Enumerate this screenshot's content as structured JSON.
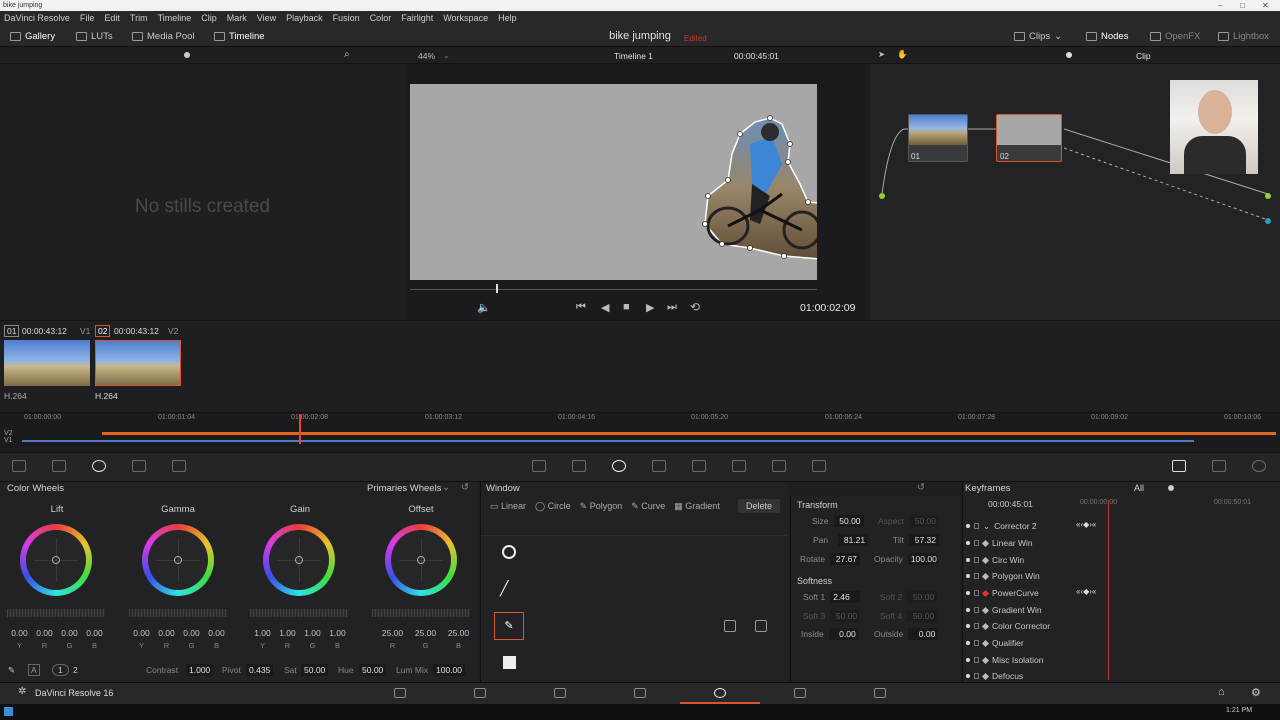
{
  "window": {
    "title": "bike jumping"
  },
  "menu": [
    "DaVinci Resolve",
    "File",
    "Edit",
    "Trim",
    "Timeline",
    "Clip",
    "Mark",
    "View",
    "Playback",
    "Fusion",
    "Color",
    "Fairlight",
    "Workspace",
    "Help"
  ],
  "topbar": {
    "left_tabs": [
      "Gallery",
      "LUTs",
      "Media Pool",
      "Timeline"
    ],
    "project_title": "bike jumping",
    "project_status": "Edited",
    "right_tabs": [
      "Clips",
      "Nodes",
      "OpenFX",
      "Lightbox"
    ]
  },
  "viewer": {
    "zoom": "44%",
    "timeline_name": "Timeline 1",
    "timecode_top": "00:00:45:01",
    "timecode": "01:00:02:09",
    "mode": "Clip"
  },
  "gallery": {
    "empty_text": "No stills created"
  },
  "nodes": [
    {
      "label": "01"
    },
    {
      "label": "02"
    }
  ],
  "clips": [
    {
      "index": "01",
      "timecode": "00:00:43:12",
      "track": "V1",
      "codec": "H.264"
    },
    {
      "index": "02",
      "timecode": "00:00:43:12",
      "track": "V2",
      "codec": "H.264"
    }
  ],
  "timeline_ticks": [
    "01:00:00:00",
    "01:00:01:04",
    "01:00:02:08",
    "01:00:03:12",
    "01:00:04:16",
    "01:00:05:20",
    "01:00:06:24",
    "01:00:07:28",
    "01:00:09:02",
    "01:00:10:06"
  ],
  "timeline_tracks": [
    "V2",
    "V1"
  ],
  "color_wheels": {
    "title": "Color Wheels",
    "mode": "Primaries Wheels",
    "wheels": [
      {
        "name": "Lift",
        "values": [
          "0.00",
          "0.00",
          "0.00",
          "0.00"
        ],
        "labels": [
          "Y",
          "R",
          "G",
          "B"
        ]
      },
      {
        "name": "Gamma",
        "values": [
          "0.00",
          "0.00",
          "0.00",
          "0.00"
        ],
        "labels": [
          "Y",
          "R",
          "G",
          "B"
        ]
      },
      {
        "name": "Gain",
        "values": [
          "1.00",
          "1.00",
          "1.00",
          "1.00"
        ],
        "labels": [
          "Y",
          "R",
          "G",
          "B"
        ]
      },
      {
        "name": "Offset",
        "values": [
          "25.00",
          "25.00",
          "25.00"
        ],
        "labels": [
          "R",
          "G",
          "B"
        ]
      }
    ],
    "page_numbers": [
      "1",
      "2"
    ],
    "params": {
      "contrast_label": "Contrast",
      "contrast": "1.000",
      "pivot_label": "Pivot",
      "pivot": "0.435",
      "sat_label": "Sat",
      "sat": "50.00",
      "hue_label": "Hue",
      "hue": "50.00",
      "lummix_label": "Lum Mix",
      "lummix": "100.00"
    }
  },
  "window_panel": {
    "title": "Window",
    "tabs": [
      "Linear",
      "Circle",
      "Polygon",
      "Curve",
      "Gradient"
    ],
    "delete_label": "Delete"
  },
  "transform": {
    "title": "Transform",
    "size_label": "Size",
    "size": "50.00",
    "aspect_label": "Aspect",
    "aspect": "50.00",
    "pan_label": "Pan",
    "pan": "81.21",
    "tilt_label": "Tilt",
    "tilt": "57.32",
    "rotate_label": "Rotate",
    "rotate": "27.67",
    "opacity_label": "Opacity",
    "opacity": "100.00",
    "softness_title": "Softness",
    "soft1_label": "Soft 1",
    "soft1": "2.46",
    "soft2_label": "Soft 2",
    "soft2": "50.00",
    "soft3_label": "Soft 3",
    "soft3": "50.00",
    "soft4_label": "Soft 4",
    "soft4": "50.00",
    "inside_label": "Inside",
    "inside": "0.00",
    "outside_label": "Outside",
    "outside": "0.00"
  },
  "keyframes": {
    "title": "Keyframes",
    "filter": "All",
    "timecode": "00:00:45:01",
    "ruler": [
      "00:00:00:00",
      "00:00:50:01"
    ],
    "rows": [
      "Corrector 2",
      "Linear Win",
      "Circ Win",
      "Polygon Win",
      "PowerCurve",
      "Gradient Win",
      "Color Corrector",
      "Qualifier",
      "Misc Isolation",
      "Defocus"
    ]
  },
  "footer": {
    "app_name": "DaVinci Resolve 16"
  },
  "taskbar": {
    "time": "1:21 PM"
  },
  "colors": {
    "accent": "#e3641e",
    "edited": "#c0392b",
    "node_selected": "#d9582b"
  }
}
